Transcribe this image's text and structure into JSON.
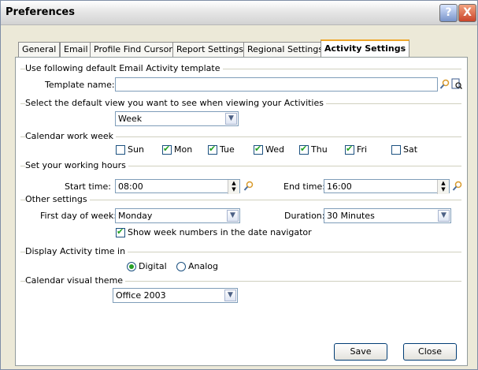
{
  "window": {
    "title": "Preferences",
    "help_label": "?",
    "close_label": "X"
  },
  "tabs": [
    "General",
    "Email",
    "Profile Find Cursor",
    "Report Settings",
    "Regional Settings",
    "Activity Settings"
  ],
  "active_tab": "Activity Settings",
  "email_template": {
    "section": "Use following default Email Activity template",
    "label": "Template name:",
    "value": ""
  },
  "default_view": {
    "section": "Select the default view you want to see when viewing your Activities",
    "value": "Week"
  },
  "work_week": {
    "section": "Calendar work week",
    "days": [
      {
        "label": "Sun",
        "checked": false
      },
      {
        "label": "Mon",
        "checked": true
      },
      {
        "label": "Tue",
        "checked": true
      },
      {
        "label": "Wed",
        "checked": true
      },
      {
        "label": "Thu",
        "checked": true
      },
      {
        "label": "Fri",
        "checked": true
      },
      {
        "label": "Sat",
        "checked": false
      }
    ]
  },
  "working_hours": {
    "section": "Set your working hours",
    "start_label": "Start time:",
    "start_value": "08:00",
    "end_label": "End time:",
    "end_value": "16:00"
  },
  "other": {
    "section": "Other settings",
    "first_day_label": "First day of week:",
    "first_day_value": "Monday",
    "duration_label": "Duration:",
    "duration_value": "30 Minutes",
    "week_numbers_label": "Show week numbers in the date navigator",
    "week_numbers_checked": true
  },
  "display_time": {
    "section": "Display Activity time in",
    "options": [
      "Digital",
      "Analog"
    ],
    "selected": "Digital"
  },
  "theme": {
    "section": "Calendar visual theme",
    "value": "Office 2003"
  },
  "buttons": {
    "save": "Save",
    "close": "Close"
  },
  "colors": {
    "accent_tab": "#f0a72a",
    "check": "#21a121",
    "input_border": "#7f9db9"
  }
}
